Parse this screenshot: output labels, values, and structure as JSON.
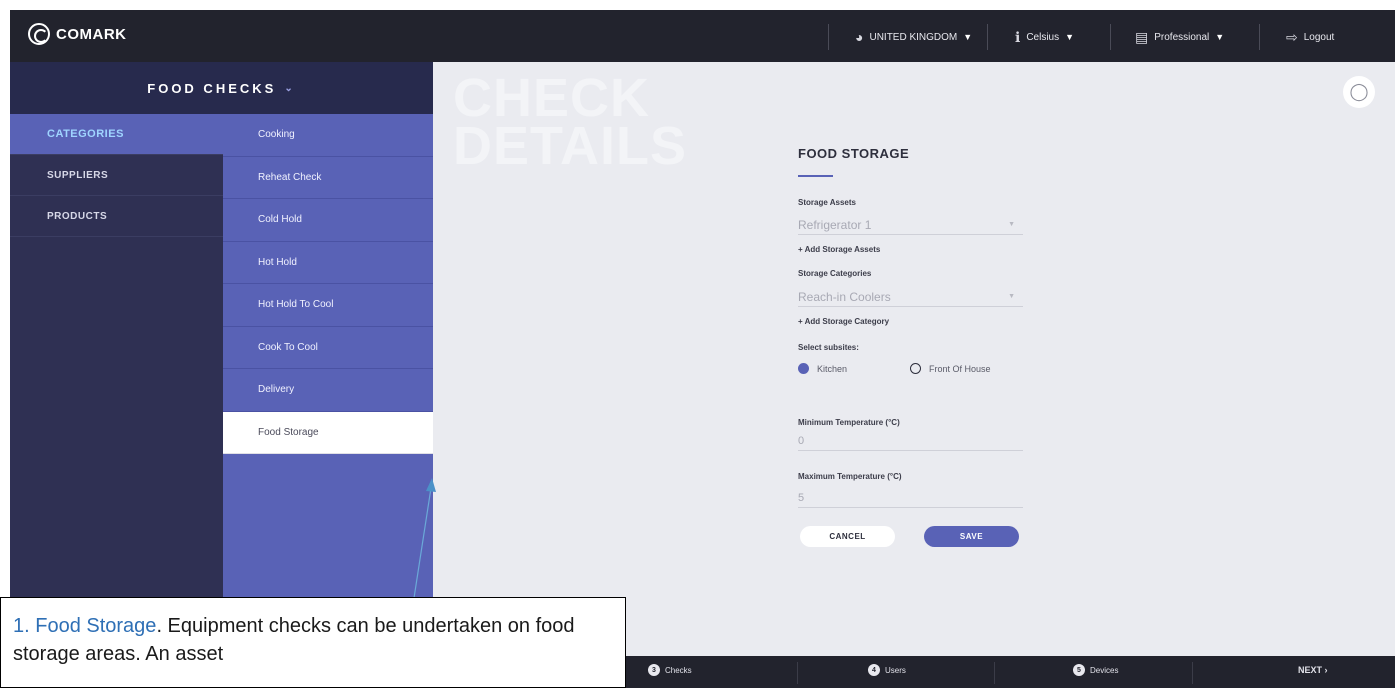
{
  "topbar": {
    "logo_text": "COMARK",
    "region": "UNITED KINGDOM",
    "unit": "Celsius",
    "plan": "Professional",
    "logout": "Logout"
  },
  "nav": {
    "header": "FOOD CHECKS",
    "categories": [
      {
        "label": "CATEGORIES",
        "active": true
      },
      {
        "label": "SUPPLIERS",
        "active": false
      },
      {
        "label": "PRODUCTS",
        "active": false
      }
    ],
    "subitems": [
      {
        "label": "Cooking",
        "active": false
      },
      {
        "label": "Reheat Check",
        "active": false
      },
      {
        "label": "Cold Hold",
        "active": false
      },
      {
        "label": "Hot Hold",
        "active": false
      },
      {
        "label": "Hot Hold To Cool",
        "active": false
      },
      {
        "label": "Cook To Cool",
        "active": false
      },
      {
        "label": "Delivery",
        "active": false
      },
      {
        "label": "Food Storage",
        "active": true
      }
    ]
  },
  "main": {
    "watermark_line1": "CHECK",
    "watermark_line2": "DETAILS",
    "form": {
      "title": "FOOD STORAGE",
      "storage_assets_label": "Storage Assets",
      "storage_assets_value": "Refrigerator 1",
      "add_storage_assets": "+ Add Storage Assets",
      "storage_categories_label": "Storage Categories",
      "storage_categories_value": "Reach-in Coolers",
      "add_storage_category": "+ Add Storage Category",
      "subsites_label": "Select subsites:",
      "subsites": [
        {
          "label": "Kitchen",
          "selected": true
        },
        {
          "label": "Front Of House",
          "selected": false
        }
      ],
      "min_temp_label": "Minimum Temperature (°C)",
      "min_temp_value": "0",
      "max_temp_label": "Maximum Temperature (°C)",
      "max_temp_value": "5",
      "cancel_label": "CANCEL",
      "save_label": "SAVE"
    }
  },
  "bottombar": {
    "steps": [
      {
        "num": "3",
        "label": "Checks"
      },
      {
        "num": "4",
        "label": "Users"
      },
      {
        "num": "5",
        "label": "Devices"
      }
    ],
    "next_label": "NEXT"
  },
  "callout": {
    "highlight": "1. Food Storage",
    "text": ".  Equipment checks can be undertaken on food storage areas.  An asset"
  },
  "colors": {
    "topbar_bg": "#22232d",
    "nav_accent": "#5962b6",
    "main_bg": "#eaebf0"
  }
}
